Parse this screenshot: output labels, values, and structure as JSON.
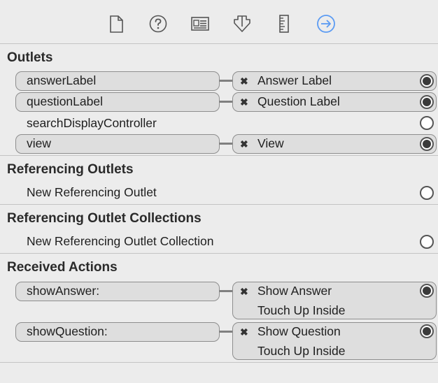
{
  "toolbar": {
    "icons": [
      "file-icon",
      "help-icon",
      "identity-icon",
      "attributes-icon",
      "size-ruler-icon",
      "connections-icon"
    ],
    "active_color": "#5b9bf3"
  },
  "outlets": {
    "title": "Outlets",
    "items": [
      {
        "name": "answerLabel",
        "target": "Answer Label"
      },
      {
        "name": "questionLabel",
        "target": "Question Label"
      },
      {
        "name": "searchDisplayController"
      },
      {
        "name": "view",
        "target": "View"
      }
    ]
  },
  "referencing_outlets": {
    "title": "Referencing Outlets",
    "new_label": "New Referencing Outlet"
  },
  "referencing_collections": {
    "title": "Referencing Outlet Collections",
    "new_label": "New Referencing Outlet Collection"
  },
  "received_actions": {
    "title": "Received Actions",
    "items": [
      {
        "name": "showAnswer:",
        "target": "Show Answer",
        "event": "Touch Up Inside"
      },
      {
        "name": "showQuestion:",
        "target": "Show Question",
        "event": "Touch Up Inside"
      }
    ]
  },
  "remove_glyph": "✖"
}
